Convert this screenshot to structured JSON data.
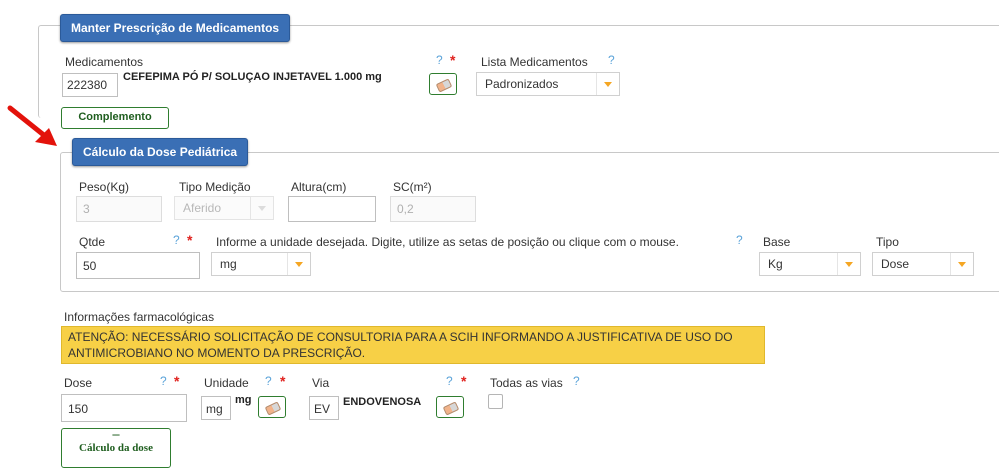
{
  "sections": {
    "main_title": "Manter Prescrição de Medicamentos",
    "pediatric_title": "Cálculo da Dose Pediátrica"
  },
  "medicamentos": {
    "label": "Medicamentos",
    "code": "222380",
    "name": "CEFEPIMA PÓ P/ SOLUÇAO INJETAVEL 1.000 mg",
    "help": "?",
    "required": "*",
    "eraser_icon": "eraser-icon"
  },
  "lista_medicamentos": {
    "label": "Lista Medicamentos",
    "help": "?",
    "selected": "Padronizados"
  },
  "complemento_label": "Complemento",
  "pediatric": {
    "peso_label": "Peso(Kg)",
    "peso_value": "3",
    "tipo_medicao_label": "Tipo Medição",
    "tipo_medicao_value": "Aferido",
    "altura_label": "Altura(cm)",
    "altura_value": "",
    "sc_label": "SC(m²)",
    "sc_value": "0,2",
    "qtde_label": "Qtde",
    "qtde_help": "?",
    "qtde_required": "*",
    "qtde_value": "50",
    "unidade_info": "Informe a unidade desejada. Digite, utilize as setas de posição ou clique com o mouse.",
    "unidade_help": "?",
    "unidade_value": "mg",
    "base_label": "Base",
    "base_value": "Kg",
    "tipo_label": "Tipo",
    "tipo_value": "Dose"
  },
  "farmaco": {
    "label": "Informações farmacológicas",
    "warning": "ATENÇÃO: NECESSÁRIO SOLICITAÇÃO DE CONSULTORIA PARA A SCIH INFORMANDO A JUSTIFICATIVA DE USO DO ANTIMICROBIANO NO MOMENTO DA PRESCRIÇÃO."
  },
  "dose": {
    "label": "Dose",
    "help": "?",
    "required": "*",
    "value": "150",
    "unidade_label": "Unidade",
    "unidade_help": "?",
    "unidade_required": "*",
    "unidade_code": "mg",
    "unidade_name": "mg",
    "via_label": "Via",
    "via_help": "?",
    "via_required": "*",
    "via_code": "EV",
    "via_name": "ENDOVENOSA",
    "todas_vias_label": "Todas as vias",
    "todas_vias_help": "?",
    "calc_button": "Cálculo da dose",
    "calc_button_mark": "–"
  },
  "colors": {
    "section_blue": "#3a6fb5",
    "green": "#2f7d2f",
    "warning_yellow": "#f7d046",
    "required_red": "#e0211d",
    "help_blue": "#5ba3d9",
    "arrow_red": "#e3120b"
  }
}
